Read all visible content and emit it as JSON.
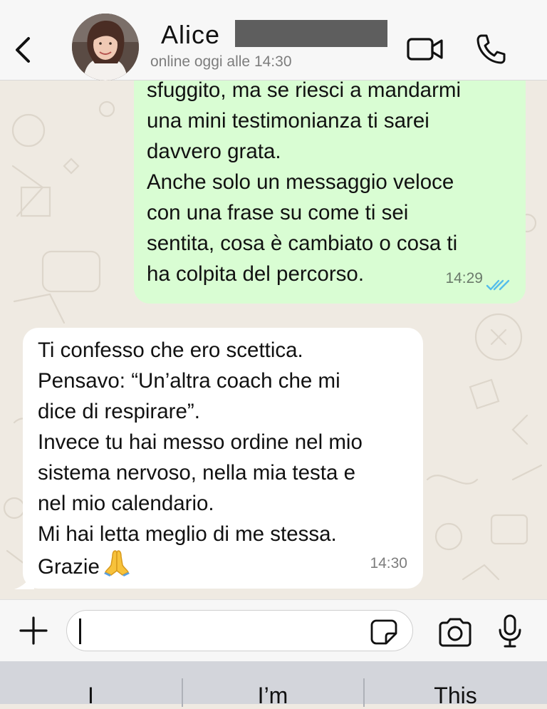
{
  "header": {
    "contact_name": "Alice",
    "status": "online oggi alle 14:30",
    "icons": {
      "back": "chevron-left-icon",
      "video": "video-camera-icon",
      "call": "phone-icon"
    }
  },
  "messages": [
    {
      "direction": "outgoing",
      "text": "sfuggito, ma se riesci a mandarmi\nuna mini testimonianza ti sarei\ndavvero grata.\nAnche solo un messaggio veloce\ncon una frase su come ti sei\nsentita, cosa è cambiato o cosa ti\nha colpita del percorso.",
      "time": "14:29",
      "status": "read",
      "tick_color": "#53bdeb"
    },
    {
      "direction": "incoming",
      "text": "Ti confesso che ero scettica.\nPensavo: “Un’altra coach che mi\ndice di respirare”.\nInvece tu hai messo ordine nel mio\nsistema nervoso, nella mia testa e\nnel mio calendario.\nMi hai letta meglio di me stessa.\nGrazie",
      "emoji": "folded-hands",
      "time": "14:30"
    }
  ],
  "input": {
    "value": "",
    "icons": {
      "plus": "plus-icon",
      "sticker": "sticker-icon",
      "camera": "camera-icon",
      "mic": "microphone-icon"
    }
  },
  "keyboard": {
    "suggestions": [
      "I",
      "I’m",
      "This"
    ]
  },
  "colors": {
    "outgoing_bubble": "#d9fdd3",
    "incoming_bubble": "#ffffff",
    "chat_background": "#efeae2",
    "read_ticks": "#53bdeb"
  }
}
